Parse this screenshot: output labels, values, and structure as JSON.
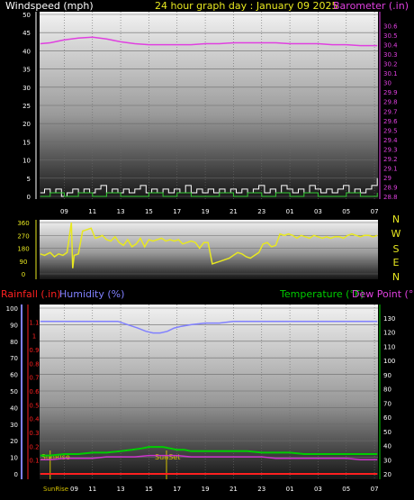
{
  "colors": {
    "background": "#000000",
    "wind": "#ffffff",
    "wind_gust": "#33cc33",
    "barometer": "#e040e0",
    "direction": "#e8e820",
    "humidity": "#8080ff",
    "temperature": "#00cc00",
    "dew_point": "#cc33cc",
    "rainfall": "#ff2020",
    "title_yellow": "#e8e820",
    "compass": "#e8e820",
    "sun": "#d4c000"
  },
  "header": {
    "windspeed_label": "Windspeed (mph)",
    "title": "24 hour graph day : January 09 2025",
    "barometer_label": "Barometer (.in)"
  },
  "lower_header": {
    "rainfall_label": "Rainfall (.in)",
    "humidity_label": "Humidity (%)",
    "temperature_label": "Temperature (°F)",
    "dewpoint_label": "Dew Point (°F)"
  },
  "compass": {
    "labels": [
      "N",
      "W",
      "S",
      "E",
      "N"
    ]
  },
  "sun": {
    "sunrise_label": "SunRise",
    "sunset_label": "SunSet",
    "sunrise_hour": 8.0,
    "sunset_hour": 16.25
  },
  "chart_data": [
    {
      "type": "line",
      "name": "wind-barometer",
      "x_ticks": [
        "09",
        "11",
        "13",
        "15",
        "17",
        "19",
        "21",
        "23",
        "01",
        "03",
        "05",
        "07"
      ],
      "x_tick_hours": [
        9,
        11,
        13,
        15,
        17,
        19,
        21,
        23,
        25,
        27,
        29,
        31
      ],
      "x_range": [
        7.25,
        31.25
      ],
      "left_axis": {
        "label": "Windspeed (mph)",
        "ylim": [
          0,
          50
        ],
        "ticks": [
          0,
          5,
          10,
          15,
          20,
          25,
          30,
          35,
          40,
          45,
          50
        ]
      },
      "right_axis": {
        "label": "Barometer (.in)",
        "ylim": [
          28.8,
          30.7
        ],
        "ticks": [
          28.8,
          28.9,
          29.0,
          29.1,
          29.2,
          29.3,
          29.4,
          29.5,
          29.6,
          29.7,
          29.8,
          29.9,
          30.0,
          30.1,
          30.2,
          30.3,
          30.4,
          30.5,
          30.6
        ],
        "tick_labels": [
          "28.8",
          "28.9",
          "29",
          "29.1",
          "29.2",
          "29.3",
          "29.4",
          "29.5",
          "29.6",
          "29.7",
          "29.8",
          "29.9",
          "30",
          "30.1",
          "30.2",
          "30.3",
          "30.4",
          "30.5",
          "30.6"
        ]
      },
      "series": [
        {
          "name": "Barometer (.in)",
          "axis": "right",
          "x": [
            7.3,
            8,
            9,
            10,
            11,
            12,
            13,
            14,
            15,
            16,
            17,
            18,
            19,
            20,
            21,
            22,
            23,
            24,
            25,
            26,
            27,
            28,
            29,
            30,
            31.2
          ],
          "y": [
            30.41,
            30.42,
            30.45,
            30.47,
            30.48,
            30.46,
            30.43,
            30.41,
            30.4,
            30.4,
            30.4,
            30.4,
            30.41,
            30.41,
            30.42,
            30.42,
            30.42,
            30.42,
            30.41,
            30.41,
            30.41,
            30.4,
            30.4,
            30.39,
            30.39
          ]
        },
        {
          "name": "Wind",
          "axis": "left",
          "x": [
            7.3,
            7.6,
            8,
            8.4,
            8.8,
            9.2,
            9.6,
            10,
            10.4,
            10.8,
            11.2,
            11.6,
            12,
            12.4,
            12.8,
            13.2,
            13.6,
            14,
            14.4,
            14.8,
            15.2,
            15.6,
            16,
            16.4,
            16.8,
            17.2,
            17.6,
            18,
            18.4,
            18.8,
            19.2,
            19.6,
            20,
            20.4,
            20.8,
            21.2,
            21.6,
            22,
            22.4,
            22.8,
            23.2,
            23.6,
            24,
            24.4,
            24.8,
            25.2,
            25.6,
            26,
            26.4,
            26.8,
            27.2,
            27.6,
            28,
            28.4,
            28.8,
            29.2,
            29.6,
            30,
            30.4,
            30.8,
            31.2
          ],
          "y": [
            1,
            2,
            1,
            2,
            0,
            1,
            2,
            1,
            2,
            1,
            2,
            3,
            1,
            2,
            1,
            2,
            1,
            2,
            3,
            1,
            2,
            1,
            2,
            1,
            2,
            1,
            3,
            1,
            2,
            1,
            2,
            1,
            2,
            1,
            2,
            1,
            2,
            1,
            2,
            3,
            1,
            2,
            1,
            3,
            2,
            1,
            2,
            1,
            3,
            2,
            1,
            2,
            1,
            2,
            3,
            1,
            2,
            1,
            2,
            3,
            5
          ]
        },
        {
          "name": "Gust",
          "axis": "left",
          "x": [
            7.3,
            8,
            9,
            10,
            11,
            12,
            13,
            14,
            15,
            16,
            17,
            18,
            19,
            20,
            21,
            22,
            23,
            24,
            25,
            26,
            27,
            28,
            29,
            30,
            31.2
          ],
          "y": [
            0,
            1,
            0,
            1,
            0,
            1,
            0,
            0,
            1,
            0,
            1,
            0,
            0,
            1,
            0,
            1,
            0,
            1,
            0,
            1,
            0,
            0,
            1,
            0,
            1
          ]
        }
      ]
    },
    {
      "type": "line",
      "name": "wind-direction",
      "left_axis": {
        "ylim": [
          0,
          360
        ],
        "ticks": [
          0,
          90,
          180,
          270,
          360
        ]
      },
      "series": [
        {
          "name": "Wind direction",
          "x": [
            7.3,
            7.6,
            8,
            8.3,
            8.6,
            8.9,
            9.2,
            9.5,
            9.6,
            9.7,
            10,
            10.3,
            10.6,
            10.9,
            11.2,
            11.5,
            11.7,
            12,
            12.3,
            12.6,
            12.9,
            13.2,
            13.5,
            13.8,
            14.1,
            14.4,
            14.7,
            15,
            15.3,
            15.6,
            15.9,
            16.2,
            16.5,
            16.8,
            17.1,
            17.4,
            17.7,
            18,
            18.3,
            18.6,
            18.9,
            19.2,
            19.5,
            19.8,
            20.1,
            20.4,
            20.7,
            21,
            21.3,
            21.6,
            21.9,
            22.2,
            22.5,
            22.8,
            23.1,
            23.4,
            23.7,
            24,
            24.3,
            24.6,
            24.9,
            25.2,
            25.5,
            25.8,
            26.1,
            26.4,
            26.7,
            27,
            27.3,
            27.6,
            27.9,
            28.2,
            28.5,
            28.8,
            29.1,
            29.4,
            29.7,
            30,
            30.3,
            30.6,
            30.9,
            31.2
          ],
          "y": [
            140,
            130,
            150,
            120,
            140,
            130,
            150,
            360,
            40,
            130,
            140,
            300,
            310,
            320,
            250,
            260,
            270,
            240,
            230,
            260,
            220,
            200,
            240,
            190,
            210,
            250,
            190,
            240,
            230,
            240,
            250,
            230,
            240,
            230,
            240,
            210,
            220,
            230,
            220,
            180,
            220,
            220,
            70,
            80,
            90,
            100,
            110,
            130,
            150,
            140,
            120,
            110,
            130,
            150,
            210,
            220,
            190,
            200,
            280,
            270,
            280,
            270,
            250,
            270,
            260,
            250,
            270,
            260,
            250,
            260,
            250,
            260,
            260,
            250,
            270,
            280,
            270,
            260,
            270,
            270,
            260,
            270
          ]
        }
      ]
    },
    {
      "type": "line",
      "name": "rain-humidity-temperature",
      "x_ticks": [
        "09",
        "11",
        "13",
        "15",
        "17",
        "19",
        "21",
        "23",
        "01",
        "03",
        "05",
        "07"
      ],
      "rain_axis": {
        "label": "Rainfall (.in)",
        "ylim": [
          0,
          1.2
        ],
        "ticks": [
          0.1,
          0.2,
          0.3,
          0.4,
          0.5,
          0.6,
          0.7,
          0.8,
          0.9,
          1.0,
          1.1
        ],
        "tick_labels": [
          "0.1",
          "0.2",
          "0.3",
          "0.4",
          "0.5",
          "0.6",
          "0.7",
          "0.8",
          "0.9",
          "1",
          "1.1"
        ]
      },
      "humidity_axis": {
        "label": "Humidity (%)",
        "ylim": [
          0,
          100
        ],
        "ticks": [
          0,
          10,
          20,
          30,
          40,
          50,
          60,
          70,
          80,
          90,
          100
        ]
      },
      "temperature_axis": {
        "label": "Temperature (°F)",
        "ylim": [
          20,
          130
        ],
        "ticks": [
          20,
          30,
          40,
          50,
          60,
          70,
          80,
          90,
          100,
          110,
          120,
          130
        ]
      },
      "series": [
        {
          "name": "Humidity (%)",
          "axis": "humidity",
          "x": [
            7.3,
            8,
            9,
            10,
            11,
            12,
            12.8,
            13.5,
            14.2,
            14.8,
            15.3,
            15.8,
            16.3,
            16.8,
            17.3,
            18,
            19,
            20,
            21,
            22,
            23,
            24,
            25,
            26,
            27,
            28,
            29,
            30,
            31.2
          ],
          "y": [
            92,
            92,
            92,
            92,
            92,
            92,
            92,
            90,
            88,
            86,
            85,
            85,
            86,
            88,
            89,
            90,
            91,
            91,
            92,
            92,
            92,
            92,
            92,
            92,
            92,
            92,
            92,
            92,
            92
          ]
        },
        {
          "name": "Temperature (°F)",
          "axis": "temperature",
          "x": [
            7.3,
            8,
            9,
            10,
            11,
            12,
            13,
            13.8,
            14.5,
            15,
            15.5,
            16,
            16.5,
            17,
            17.5,
            18,
            19,
            20,
            21,
            22,
            23,
            24,
            25,
            26,
            27,
            28,
            29,
            30,
            31.2
          ],
          "y": [
            33,
            33,
            34,
            34,
            35,
            35,
            36,
            37,
            38,
            39,
            39,
            39,
            38,
            37,
            37,
            36,
            36,
            36,
            36,
            36,
            35,
            35,
            35,
            34,
            34,
            34,
            34,
            34,
            34
          ]
        },
        {
          "name": "Dew Point (°F)",
          "axis": "temperature",
          "x": [
            7.3,
            8,
            9,
            10,
            11,
            12,
            13,
            14,
            15,
            16,
            17,
            18,
            19,
            20,
            21,
            22,
            23,
            24,
            25,
            26,
            27,
            28,
            29,
            30,
            31.2
          ],
          "y": [
            30,
            30,
            31,
            31,
            31,
            32,
            32,
            32,
            33,
            33,
            33,
            32,
            32,
            32,
            32,
            32,
            32,
            31,
            31,
            31,
            31,
            31,
            31,
            30,
            30
          ]
        },
        {
          "name": "Rainfall (.in)",
          "axis": "rain",
          "x": [
            7.3,
            31.2
          ],
          "y": [
            0,
            0
          ]
        }
      ]
    }
  ]
}
